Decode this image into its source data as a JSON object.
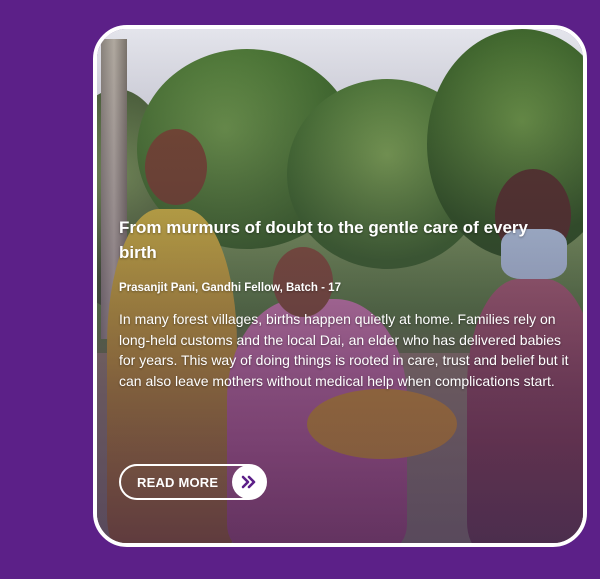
{
  "card": {
    "title": "From murmurs of doubt to the gentle care of every birth",
    "byline": "Prasanjit Pani, Gandhi Fellow, Batch - 17",
    "body": "In many forest villages, births happen quietly at home. Families rely on long-held customs and the local Dai, an elder who has delivered babies for years. This way of doing things is rooted in care, trust and belief but it can also leave mothers without medical help when complications start.",
    "cta_label": "READ MORE",
    "cta_icon": "double-chevron-right-icon"
  },
  "colors": {
    "background": "#5c2088",
    "card_border": "#ffffff",
    "text": "#ffffff",
    "icon": "#5c2088"
  }
}
